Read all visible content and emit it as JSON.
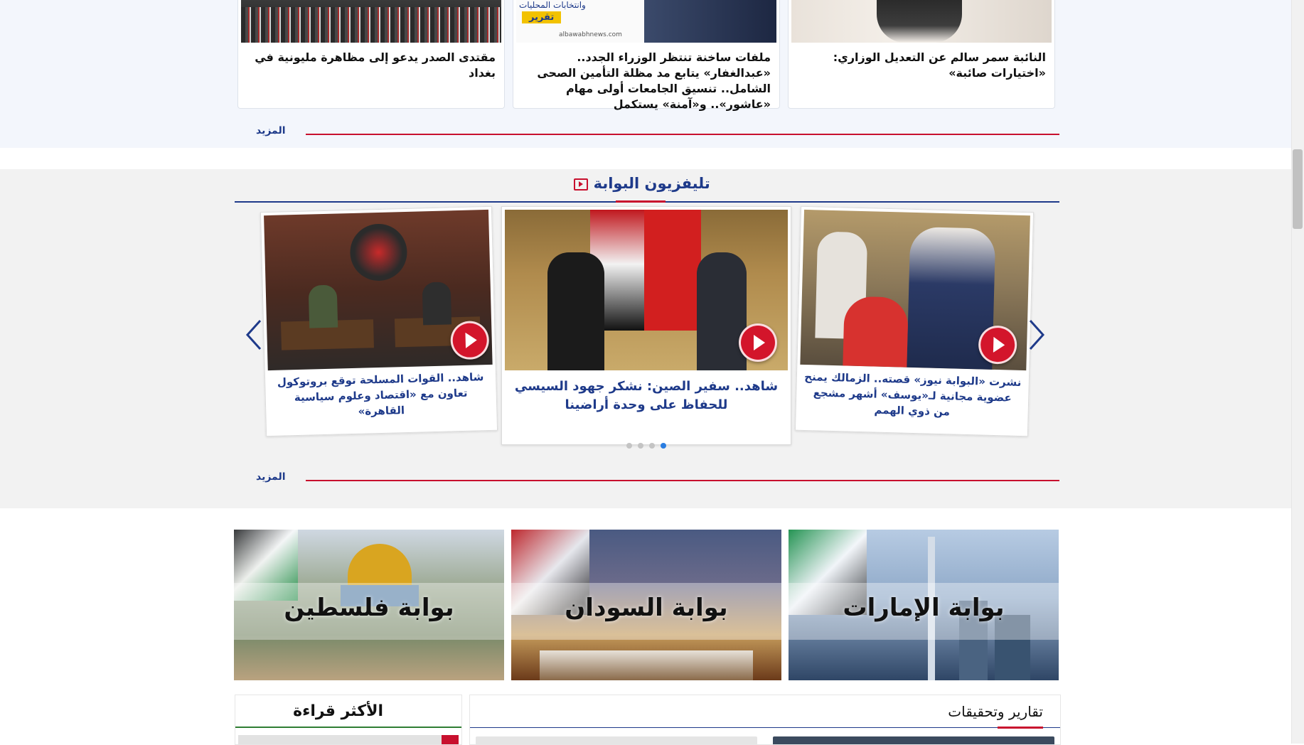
{
  "top_cards": [
    {
      "title": "النائبة سمر سالم عن التعديل الوزاري: «اختيارات صائبة»"
    },
    {
      "title": "ملفات ساخنة تنتظر الوزراء الجدد.. «عبدالغفار» يتابع مد مظلة التأمين الصحى الشامل.. تنسيق الجامعات أولى مهام «عاشور».. و«آمنة» يستكمل",
      "image_tag": "تقرير",
      "image_caption": "وانتخابات المحليات",
      "image_site": "albawabhnews.com"
    },
    {
      "title": "مقتدى الصدر يدعو إلى مظاهرة مليونية في بغداد"
    }
  ],
  "more_label": "المزيد",
  "tv": {
    "section_title": "تليفزيون البوابة",
    "videos": [
      {
        "title": "نشرت «البوابة نيوز» قصته.. الزمالك يمنح عضوية مجانية لـ«يوسف» أشهر مشجع من ذوي الهمم"
      },
      {
        "title": "شاهد.. سفير الصين: نشكر جهود السيسي للحفاظ على وحدة أراضينا"
      },
      {
        "title": "شاهد.. القوات المسلحة توقع بروتوكول تعاون مع «اقتصاد وعلوم سياسية القاهرة»"
      }
    ],
    "pagination_count": 4,
    "active_page": 1
  },
  "gateways": [
    {
      "label": "بوابة الإمارات"
    },
    {
      "label": "بوابة السودان"
    },
    {
      "label": "بوابة فلسطين"
    }
  ],
  "most_read": {
    "title": "الأكثر قراءة"
  },
  "reports": {
    "title": "تقارير وتحقيقات"
  },
  "colors": {
    "brand_blue": "#1e3a8a",
    "accent_red": "#c8102e",
    "play_red": "#d3152b",
    "green": "#2e7d32"
  },
  "icons": [
    "tv-icon",
    "play-icon",
    "arrow-left-icon",
    "arrow-right-icon"
  ]
}
